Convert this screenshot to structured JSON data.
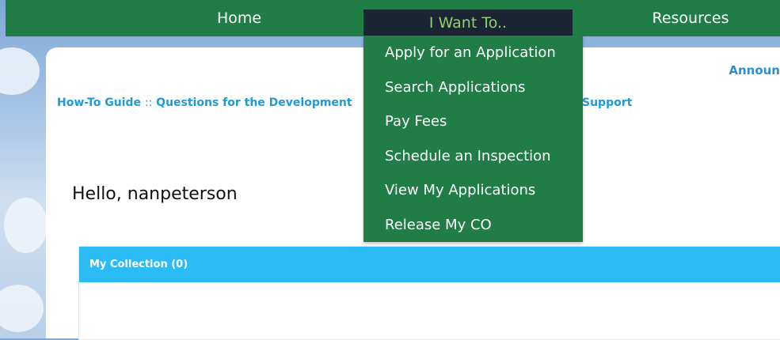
{
  "nav": {
    "home": "Home",
    "i_want_to": "I Want To..",
    "resources": "Resources"
  },
  "dropdown": {
    "items": [
      "Apply for an Application",
      "Search Applications",
      "Pay Fees",
      "Schedule an Inspection",
      "View My Applications",
      "Release My CO"
    ]
  },
  "links": {
    "how_to_guide": "How-To Guide",
    "separator": "::",
    "questions": "Questions for the Development",
    "support": "Support",
    "announcements": "Announ"
  },
  "greeting": "Hello, nanpeterson",
  "collection": {
    "title": "My Collection (0)"
  },
  "colors": {
    "nav_green": "#217d46",
    "active_tab_bg": "#1b2433",
    "active_tab_text": "#8fcf6f",
    "collection_blue": "#2bbcf5",
    "link_blue": "#1e9ad6"
  }
}
